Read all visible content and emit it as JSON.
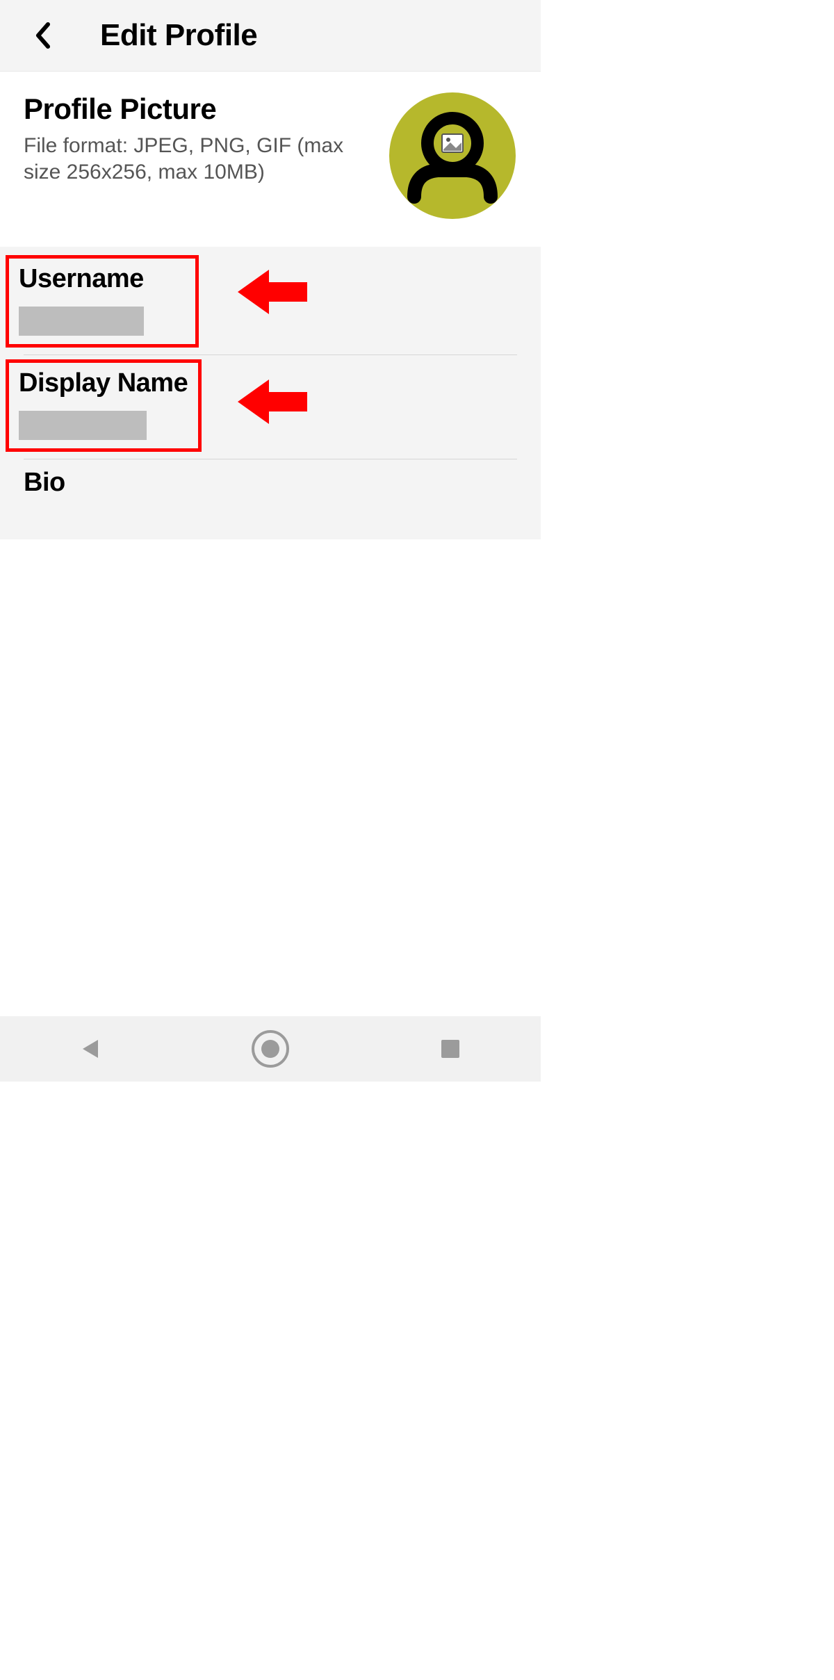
{
  "header": {
    "title": "Edit Profile"
  },
  "picture": {
    "title": "Profile Picture",
    "subtitle": "File format: JPEG, PNG, GIF (max size 256x256, max 10MB)"
  },
  "fields": {
    "username_label": "Username",
    "displayname_label": "Display Name",
    "bio_label": "Bio"
  },
  "colors": {
    "highlight": "#ff0000",
    "avatar_bg": "#b6b82c"
  }
}
